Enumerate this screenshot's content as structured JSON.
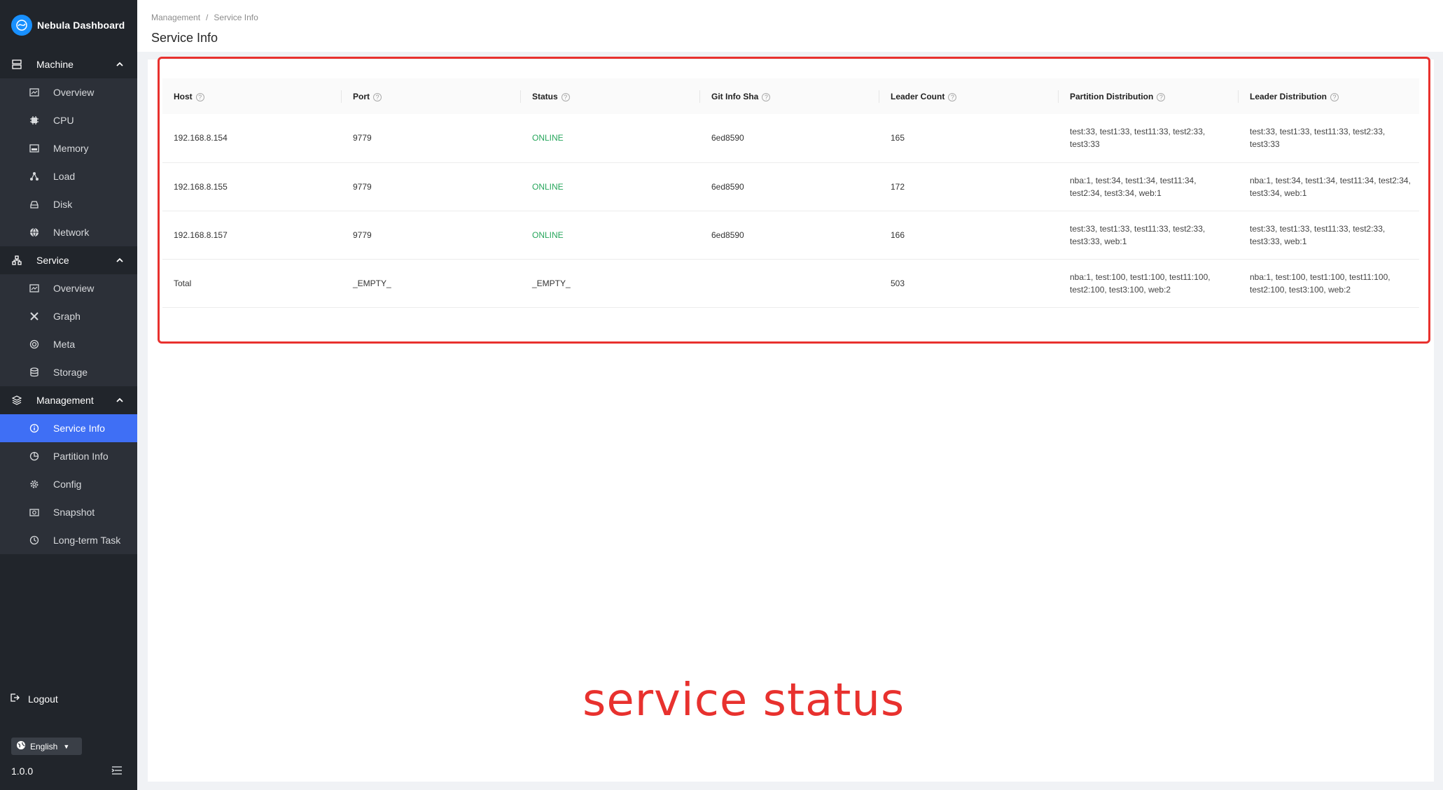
{
  "app": {
    "name": "Nebula Dashboard"
  },
  "sidebar": {
    "groups": [
      {
        "label": "Machine",
        "icon": "server-icon",
        "items": [
          {
            "label": "Overview",
            "icon": "dashboard-icon"
          },
          {
            "label": "CPU",
            "icon": "cpu-icon"
          },
          {
            "label": "Memory",
            "icon": "memory-icon"
          },
          {
            "label": "Load",
            "icon": "load-icon"
          },
          {
            "label": "Disk",
            "icon": "disk-icon"
          },
          {
            "label": "Network",
            "icon": "globe-icon"
          }
        ]
      },
      {
        "label": "Service",
        "icon": "cluster-icon",
        "items": [
          {
            "label": "Overview",
            "icon": "dashboard-icon"
          },
          {
            "label": "Graph",
            "icon": "graph-tools-icon"
          },
          {
            "label": "Meta",
            "icon": "meta-icon"
          },
          {
            "label": "Storage",
            "icon": "database-icon"
          }
        ]
      },
      {
        "label": "Management",
        "icon": "layers-icon",
        "items": [
          {
            "label": "Service Info",
            "icon": "info-icon",
            "active": true
          },
          {
            "label": "Partition Info",
            "icon": "pie-icon"
          },
          {
            "label": "Config",
            "icon": "gear-icon"
          },
          {
            "label": "Snapshot",
            "icon": "camera-icon"
          },
          {
            "label": "Long-term Task",
            "icon": "clock-icon"
          }
        ]
      }
    ],
    "logout": "Logout",
    "language": "English",
    "version": "1.0.0",
    "active_color": "#3f6ff5",
    "background": "#21252b"
  },
  "header": {
    "breadcrumb": [
      "Management",
      "Service Info"
    ],
    "title": "Service Info"
  },
  "table": {
    "columns": [
      "Host",
      "Port",
      "Status",
      "Git Info Sha",
      "Leader Count",
      "Partition Distribution",
      "Leader Distribution"
    ],
    "rows": [
      {
        "host": "192.168.8.154",
        "port": "9779",
        "status": "ONLINE",
        "git": "6ed8590",
        "leader_count": "165",
        "partition": "test:33, test1:33, test11:33, test2:33, test3:33",
        "leader": "test:33, test1:33, test11:33, test2:33, test3:33"
      },
      {
        "host": "192.168.8.155",
        "port": "9779",
        "status": "ONLINE",
        "git": "6ed8590",
        "leader_count": "172",
        "partition": "nba:1, test:34, test1:34, test11:34, test2:34, test3:34, web:1",
        "leader": "nba:1, test:34, test1:34, test11:34, test2:34, test3:34, web:1"
      },
      {
        "host": "192.168.8.157",
        "port": "9779",
        "status": "ONLINE",
        "git": "6ed8590",
        "leader_count": "166",
        "partition": "test:33, test1:33, test11:33, test2:33, test3:33, web:1",
        "leader": "test:33, test1:33, test11:33, test2:33, test3:33, web:1"
      },
      {
        "host": "Total",
        "port": "_EMPTY_",
        "status": "_EMPTY_",
        "git": "",
        "leader_count": "503",
        "partition": "nba:1, test:100, test1:100, test11:100, test2:100, test3:100, web:2",
        "leader": "nba:1, test:100, test1:100, test11:100, test2:100, test3:100, web:2"
      }
    ],
    "online_color": "#26a65b"
  },
  "annotation": {
    "text": "service status",
    "color": "#e8312e"
  }
}
